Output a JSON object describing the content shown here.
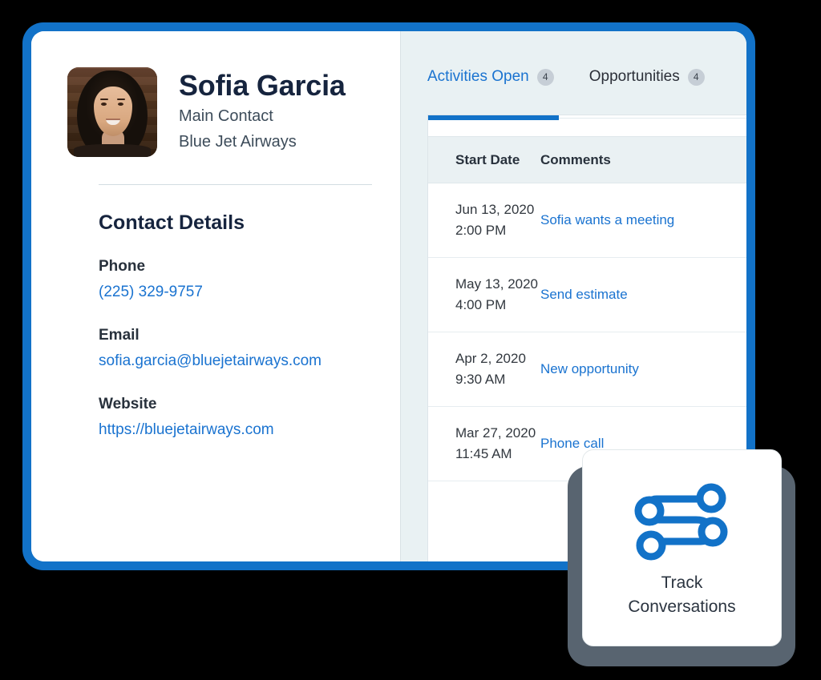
{
  "theme": {
    "frame_blue": "#1272c8",
    "link_blue": "#1a73d0",
    "heading_navy": "#16243e",
    "panel_bg": "#e9f1f3",
    "shadow_slate": "#586470"
  },
  "contact": {
    "avatar_alt": "Sofia Garcia portrait photo",
    "name": "Sofia Garcia",
    "role": "Main Contact",
    "company": "Blue Jet Airways",
    "details_title": "Contact Details",
    "fields": [
      {
        "label": "Phone",
        "value": "(225) 329-9757"
      },
      {
        "label": "Email",
        "value": "sofia.garcia@bluejetairways.com"
      },
      {
        "label": "Website",
        "value": "https://bluejetairways.com"
      }
    ]
  },
  "tabs": [
    {
      "label": "Activities Open",
      "badge": "4",
      "active": true
    },
    {
      "label": "Opportunities",
      "badge": "4",
      "active": false
    }
  ],
  "table": {
    "columns": [
      "Start Date",
      "Comments"
    ],
    "rows": [
      {
        "date": "Jun 13, 2020",
        "time": "2:00 PM",
        "comment": "Sofia wants a meeting"
      },
      {
        "date": "May 13, 2020",
        "time": "4:00 PM",
        "comment": "Send estimate"
      },
      {
        "date": "Apr 2, 2020",
        "time": "9:30 AM",
        "comment": "New opportunity"
      },
      {
        "date": "Mar 27, 2020",
        "time": "11:45 AM",
        "comment": "Phone call"
      }
    ]
  },
  "feature_card": {
    "icon": "conversation-route-icon",
    "title_line1": "Track",
    "title_line2": "Conversations"
  }
}
